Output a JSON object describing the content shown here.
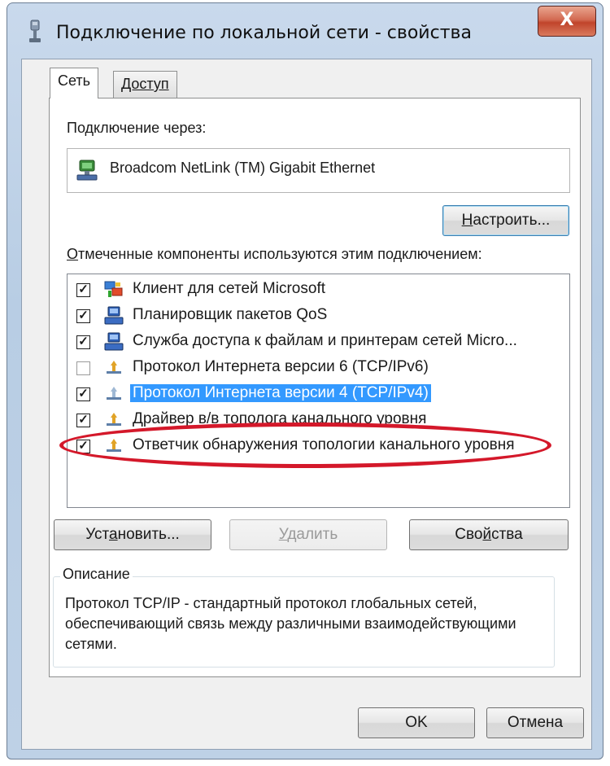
{
  "window": {
    "title": "Подключение по локальной сети - свойства",
    "close_glyph": "X"
  },
  "tabs": [
    {
      "label": "Сеть",
      "active": true
    },
    {
      "label": "Доступ",
      "active": false
    }
  ],
  "connection": {
    "label": "Подключение через:",
    "adapter_name": "Broadcom NetLink (TM) Gigabit Ethernet",
    "configure_button": {
      "underlined": "Н",
      "rest": "астроить..."
    }
  },
  "components": {
    "label_underlined": "О",
    "label_rest": "тмеченные компоненты используются этим подключением:",
    "items": [
      {
        "label": "Клиент для сетей Microsoft",
        "checked": true,
        "icon": "network-client-icon",
        "selected": false
      },
      {
        "label": "Планировщик пакетов QoS",
        "checked": true,
        "icon": "network-service-icon",
        "selected": false
      },
      {
        "label": "Служба доступа к файлам и принтерам сетей Micro...",
        "checked": true,
        "icon": "network-service-icon",
        "selected": false
      },
      {
        "label": "Протокол Интернета версии 6 (TCP/IPv6)",
        "checked": false,
        "icon": "network-protocol-icon",
        "selected": false
      },
      {
        "label": "Протокол Интернета версии 4 (TCP/IPv4)",
        "checked": true,
        "icon": "network-protocol-icon",
        "selected": true
      },
      {
        "label": "Драйвер в/в тополога канального уровня",
        "checked": true,
        "icon": "network-protocol-icon",
        "selected": false
      },
      {
        "label": "Ответчик обнаружения топологии канального уровня",
        "checked": true,
        "icon": "network-protocol-icon",
        "selected": false
      }
    ],
    "check_glyph": "✓"
  },
  "actions": {
    "install": {
      "pre": "Уст",
      "underlined": "а",
      "post": "новить..."
    },
    "remove": {
      "pre": "",
      "underlined": "У",
      "post": "далить"
    },
    "properties": {
      "pre": "Сво",
      "underlined": "й",
      "post": "ства"
    }
  },
  "description": {
    "legend": "Описание",
    "text": "Протокол TCP/IP - стандартный протокол глобальных сетей, обеспечивающий связь между различными взаимодействующими сетями."
  },
  "footer": {
    "ok_label": "OK",
    "cancel_label": "Отмена"
  },
  "colors": {
    "selection": "#3399ff",
    "highlight_ellipse": "#d4182a",
    "close_button": "#c0442b"
  }
}
